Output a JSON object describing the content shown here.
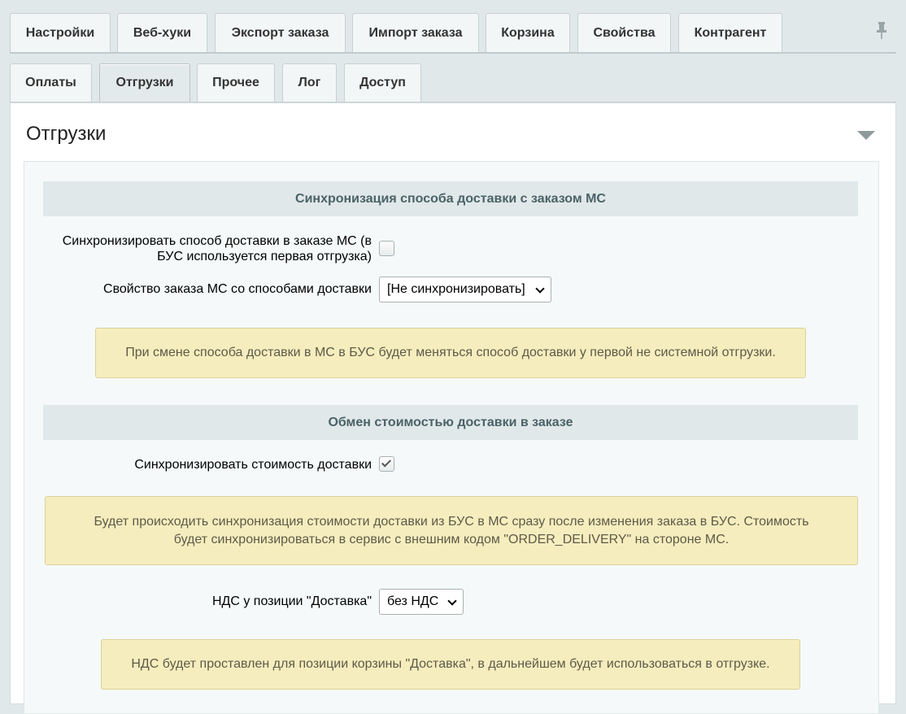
{
  "tabs_top": [
    {
      "label": "Настройки"
    },
    {
      "label": "Веб-хуки"
    },
    {
      "label": "Экспорт заказа"
    },
    {
      "label": "Импорт заказа"
    },
    {
      "label": "Корзина"
    },
    {
      "label": "Свойства"
    },
    {
      "label": "Контрагент"
    }
  ],
  "tabs_sub": [
    {
      "label": "Оплаты"
    },
    {
      "label": "Отгрузки"
    },
    {
      "label": "Прочее"
    },
    {
      "label": "Лог"
    },
    {
      "label": "Доступ"
    }
  ],
  "panel": {
    "title": "Отгрузки"
  },
  "section1": {
    "header": "Синхронизация способа доставки с заказом МС",
    "sync_label_line1": "Синхронизировать способ доставки в заказе МС (в",
    "sync_label_line2": "БУС используется первая отгрузка)",
    "sync_checked": false,
    "property_label": "Свойство заказа МС со способами доставки",
    "property_value": "[Не синхронизировать]",
    "note": "При смене способа доставки в МС в БУС будет меняться способ доставки у первой не системной отгрузки."
  },
  "section2": {
    "header": "Обмен стоимостью доставки в заказе",
    "cost_label": "Синхронизировать стоимость доставки",
    "cost_checked": true,
    "note_line1": "Будет происходить синхронизация стоимости доставки из БУС в МС сразу после изменения заказа в БУС. Стоимость",
    "note_line2": "будет синхронизироваться в сервис с внешним кодом \"ORDER_DELIVERY\" на стороне МС.",
    "vat_label": "НДС у позиции \"Доставка\"",
    "vat_value": "без НДС",
    "vat_note": "НДС будет проставлен для позиции корзины \"Доставка\", в дальнейшем будет использоваться в отгрузке."
  }
}
